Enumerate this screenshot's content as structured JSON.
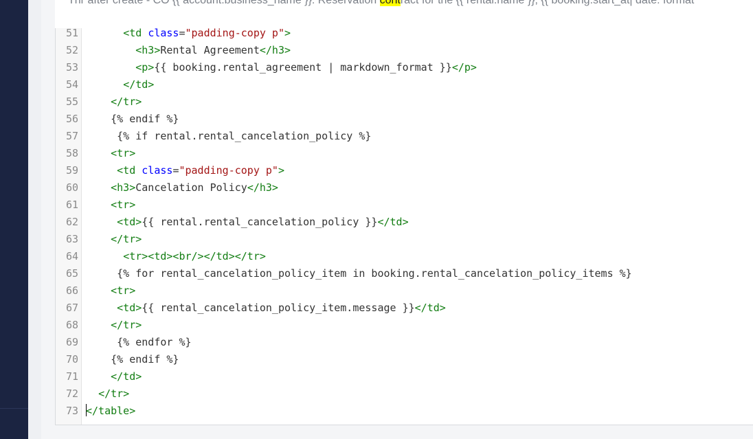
{
  "subject": {
    "before": "Thr after create - CO {{ account.business_name }}: Reservation ",
    "highlight": "cont",
    "after": "ract for the {{ rental.name }}, {{ booking.start_at| date: format"
  },
  "editor": {
    "lines": [
      {
        "n": "51",
        "tokens": [
          [
            "t",
            "      "
          ],
          [
            "g",
            "<td "
          ],
          [
            "a",
            "class"
          ],
          [
            "t",
            "="
          ],
          [
            "s",
            "\"padding-copy p\""
          ],
          [
            "g",
            ">"
          ]
        ]
      },
      {
        "n": "52",
        "tokens": [
          [
            "t",
            "        "
          ],
          [
            "g",
            "<h3>"
          ],
          [
            "t",
            "Rental Agreement"
          ],
          [
            "g",
            "</h3>"
          ]
        ]
      },
      {
        "n": "53",
        "tokens": [
          [
            "t",
            "        "
          ],
          [
            "g",
            "<p>"
          ],
          [
            "t",
            "{{ booking.rental_agreement | markdown_format }}"
          ],
          [
            "g",
            "</p>"
          ]
        ]
      },
      {
        "n": "54",
        "tokens": [
          [
            "t",
            "      "
          ],
          [
            "g",
            "</td>"
          ]
        ]
      },
      {
        "n": "55",
        "tokens": [
          [
            "t",
            "    "
          ],
          [
            "g",
            "</tr>"
          ]
        ]
      },
      {
        "n": "56",
        "tokens": [
          [
            "t",
            "    {% endif %}"
          ]
        ]
      },
      {
        "n": "57",
        "tokens": [
          [
            "t",
            "     {% if rental.rental_cancelation_policy %}"
          ]
        ]
      },
      {
        "n": "58",
        "tokens": [
          [
            "t",
            "    "
          ],
          [
            "g",
            "<tr>"
          ]
        ]
      },
      {
        "n": "59",
        "tokens": [
          [
            "t",
            "     "
          ],
          [
            "g",
            "<td "
          ],
          [
            "a",
            "class"
          ],
          [
            "t",
            "="
          ],
          [
            "s",
            "\"padding-copy p\""
          ],
          [
            "g",
            ">"
          ]
        ]
      },
      {
        "n": "60",
        "tokens": [
          [
            "t",
            "    "
          ],
          [
            "g",
            "<h3>"
          ],
          [
            "t",
            "Cancelation Policy"
          ],
          [
            "g",
            "</h3>"
          ]
        ]
      },
      {
        "n": "61",
        "tokens": [
          [
            "t",
            "    "
          ],
          [
            "g",
            "<tr>"
          ]
        ]
      },
      {
        "n": "62",
        "tokens": [
          [
            "t",
            "     "
          ],
          [
            "g",
            "<td>"
          ],
          [
            "t",
            "{{ rental.rental_cancelation_policy }}"
          ],
          [
            "g",
            "</td>"
          ]
        ]
      },
      {
        "n": "63",
        "tokens": [
          [
            "t",
            "    "
          ],
          [
            "g",
            "</tr>"
          ]
        ]
      },
      {
        "n": "64",
        "tokens": [
          [
            "t",
            "      "
          ],
          [
            "g",
            "<tr><td><br/></td></tr>"
          ]
        ]
      },
      {
        "n": "65",
        "tokens": [
          [
            "t",
            "     {% for rental_cancelation_policy_item in booking.rental_cancelation_policy_items %}"
          ]
        ]
      },
      {
        "n": "66",
        "tokens": [
          [
            "t",
            "    "
          ],
          [
            "g",
            "<tr>"
          ]
        ]
      },
      {
        "n": "67",
        "tokens": [
          [
            "t",
            "     "
          ],
          [
            "g",
            "<td>"
          ],
          [
            "t",
            "{{ rental_cancelation_policy_item.message }}"
          ],
          [
            "g",
            "</td>"
          ]
        ]
      },
      {
        "n": "68",
        "tokens": [
          [
            "t",
            "    "
          ],
          [
            "g",
            "</tr>"
          ]
        ]
      },
      {
        "n": "69",
        "tokens": [
          [
            "t",
            "     {% endfor %}"
          ]
        ]
      },
      {
        "n": "70",
        "tokens": [
          [
            "t",
            "    {% endif %}"
          ]
        ]
      },
      {
        "n": "71",
        "tokens": [
          [
            "t",
            "    "
          ],
          [
            "g",
            "</td>"
          ]
        ]
      },
      {
        "n": "72",
        "tokens": [
          [
            "t",
            "  "
          ],
          [
            "g",
            "</tr>"
          ]
        ]
      },
      {
        "n": "73",
        "cursor": true,
        "tokens": [
          [
            "g",
            "</table>"
          ]
        ]
      }
    ]
  }
}
